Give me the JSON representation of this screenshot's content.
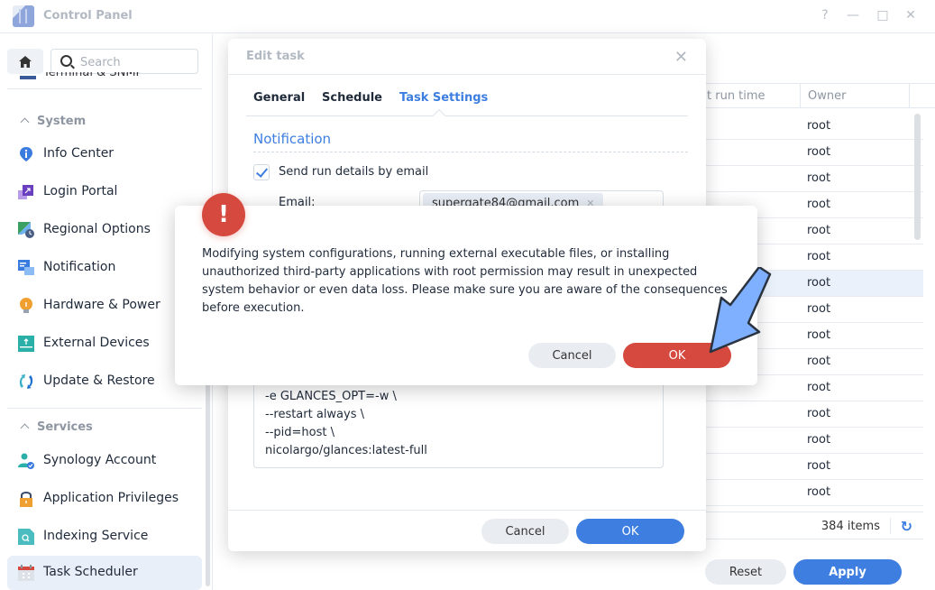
{
  "window": {
    "title": "Control Panel",
    "controls": [
      "?",
      "—",
      "□",
      "✕"
    ]
  },
  "sidebar": {
    "search_placeholder": "Search",
    "cut_item": "Terminal & SNMP",
    "sections": [
      {
        "title": "System",
        "items": [
          {
            "label": "Info Center",
            "icon": "info-icon",
            "color": "#3a7be0"
          },
          {
            "label": "Login Portal",
            "icon": "login-portal-icon",
            "color": "#6a3fc0"
          },
          {
            "label": "Regional Options",
            "icon": "regional-options-icon",
            "color": "#3aa064"
          },
          {
            "label": "Notification",
            "icon": "notification-icon",
            "color": "#3a7be0"
          },
          {
            "label": "Hardware & Power",
            "icon": "lightbulb-icon",
            "color": "#f0a030"
          },
          {
            "label": "External Devices",
            "icon": "external-devices-icon",
            "color": "#2ab0a8"
          },
          {
            "label": "Update & Restore",
            "icon": "update-restore-icon",
            "color": "#1e8fd0"
          }
        ]
      },
      {
        "title": "Services",
        "items": [
          {
            "label": "Synology Account",
            "icon": "synology-account-icon",
            "color": "#2ab0a8"
          },
          {
            "label": "Application Privileges",
            "icon": "lock-icon",
            "color": "#f0a030"
          },
          {
            "label": "Indexing Service",
            "icon": "indexing-service-icon",
            "color": "#2ab0a8"
          },
          {
            "label": "Task Scheduler",
            "icon": "calendar-icon",
            "color": "#d5493f",
            "active": true
          }
        ]
      }
    ]
  },
  "grid": {
    "columns": [
      "Next run time",
      "Owner"
    ],
    "column_visible": [
      "t run time",
      "Owner"
    ],
    "rows": [
      "root",
      "root",
      "root",
      "root",
      "root",
      "root",
      "root",
      "root",
      "root",
      "root",
      "root",
      "root",
      "root",
      "root",
      "root"
    ],
    "selected_row": 6,
    "items_count": "384 items",
    "refresh_icon": "refresh-icon"
  },
  "page_buttons": {
    "reset": "Reset",
    "apply": "Apply"
  },
  "edit_dialog": {
    "title": "Edit task",
    "tabs": [
      "General",
      "Schedule",
      "Task Settings"
    ],
    "active_tab": "Task Settings",
    "section_title": "Notification",
    "send_email_label": "Send run details by email",
    "send_email_checked": true,
    "email_label": "Email:",
    "email_value": "supergate84@gmail.com",
    "script_lines": [
      "-e GLANCES_OPT=-w \\",
      "--restart always \\",
      "--pid=host \\",
      "nicolargo/glances:latest-full"
    ],
    "cancel": "Cancel",
    "ok": "OK"
  },
  "alert": {
    "icon": "!",
    "message": "Modifying system configurations, running external executable files, or installing unauthorized third-party applications with root permission may result in unexpected system behavior or even data loss. Please make sure you are aware of the consequences before execution.",
    "cancel": "Cancel",
    "ok": "OK"
  },
  "colors": {
    "accent": "#3d7ee0",
    "danger": "#d5493f",
    "annotation_arrow": "#7fb0ff"
  }
}
